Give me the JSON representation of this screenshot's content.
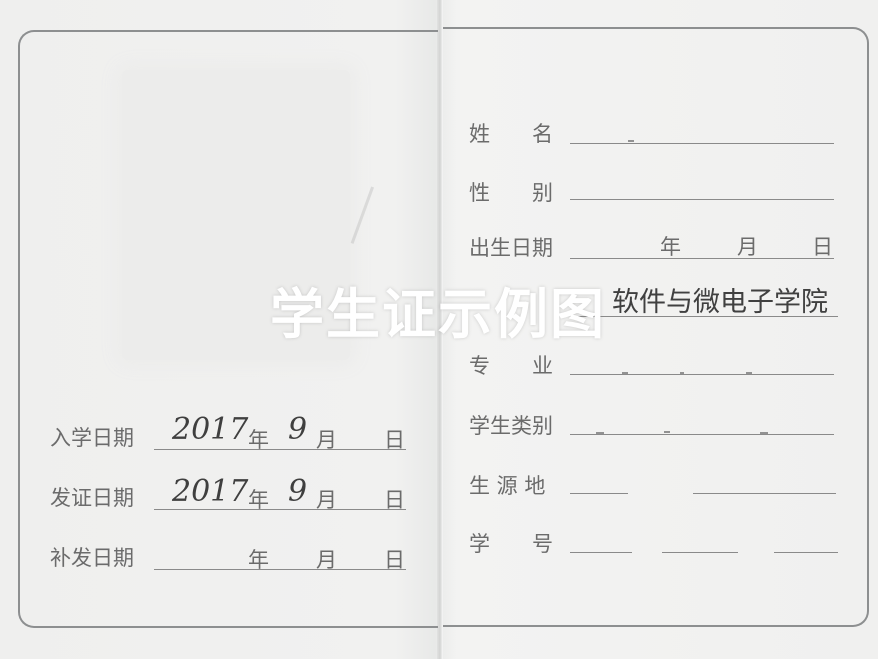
{
  "watermark": "学生证示例图",
  "left": {
    "rows": [
      {
        "label": "入学日期",
        "year": "2017",
        "month": "9",
        "year_unit": "年",
        "month_unit": "月",
        "day_unit": "日"
      },
      {
        "label": "发证日期",
        "year": "2017",
        "month": "9",
        "year_unit": "年",
        "month_unit": "月",
        "day_unit": "日"
      },
      {
        "label": "补发日期",
        "year": "",
        "month": "",
        "year_unit": "年",
        "month_unit": "月",
        "day_unit": "日"
      }
    ]
  },
  "right": {
    "name_label": "姓　　名",
    "gender_label": "性　　别",
    "dob_label": "出生日期",
    "dob_units": {
      "year": "年",
      "month": "月",
      "day": "日"
    },
    "college_value": "软件与微电子学院",
    "major_label": "专　　业",
    "category_label": "学生类别",
    "origin_label": "生 源 地",
    "id_label": "学　　号"
  }
}
